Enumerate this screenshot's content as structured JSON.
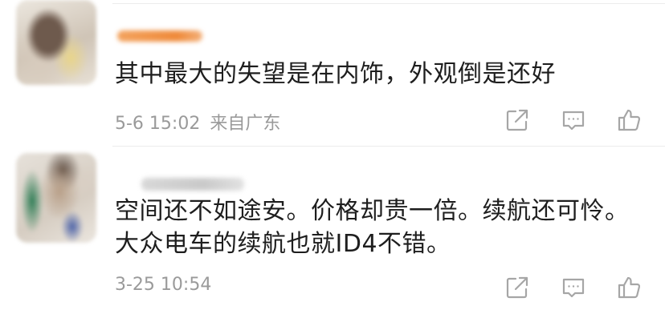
{
  "comments": [
    {
      "text_lines": [
        "其中最大的失望是在内饰，外观倒是还好"
      ],
      "date": "5-6 15:02",
      "location": "来自广东",
      "actions": {
        "share_icon": "share-icon",
        "comment_icon": "comment-icon",
        "like_icon": "thumbs-up-icon"
      }
    },
    {
      "text_lines": [
        "空间还不如途安。价格却贵一倍。续航还可怜。",
        "大众电车的续航也就ID4不错。"
      ],
      "date": "3-25 10:54",
      "location": "",
      "actions": {
        "share_icon": "share-icon",
        "comment_icon": "comment-icon",
        "like_icon": "thumbs-up-icon"
      }
    }
  ],
  "colors": {
    "text": "#1e1e1e",
    "meta": "#9a9a9a",
    "icon": "#a6a6a6",
    "divider": "#ececec"
  }
}
